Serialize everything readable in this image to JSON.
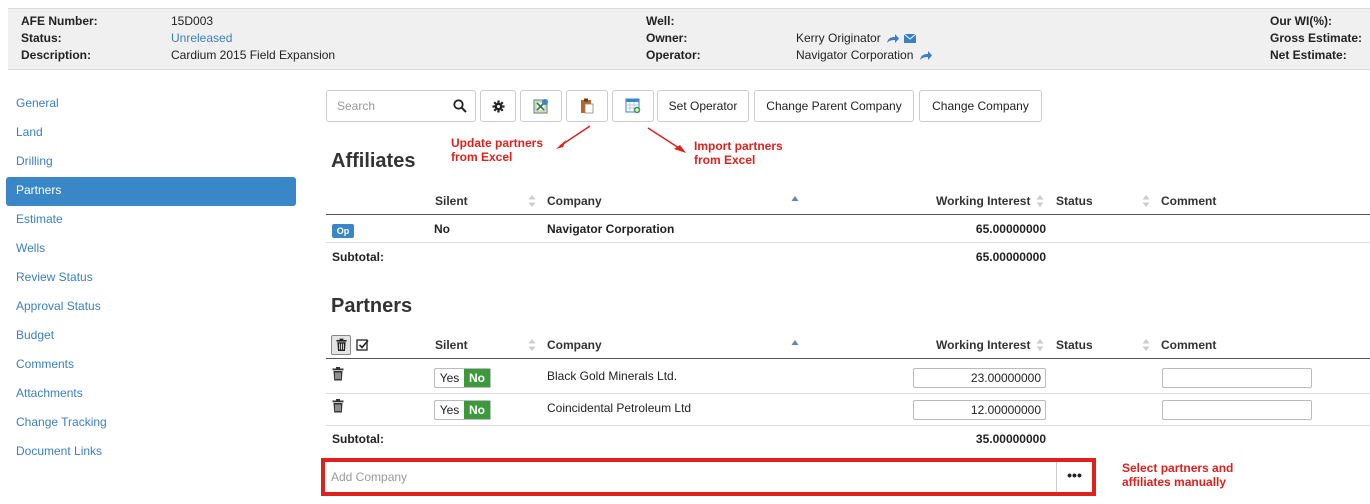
{
  "header": {
    "afe_number_label": "AFE Number:",
    "afe_number_value": "15D003",
    "status_label": "Status:",
    "status_value": "Unreleased",
    "description_label": "Description:",
    "description_value": "Cardium 2015 Field Expansion",
    "well_label": "Well:",
    "well_value": "",
    "owner_label": "Owner:",
    "owner_value": "Kerry Originator",
    "operator_label": "Operator:",
    "operator_value": "Navigator Corporation",
    "our_wi_label": "Our WI(%):",
    "gross_estimate_label": "Gross Estimate:",
    "net_estimate_label": "Net Estimate:"
  },
  "sidebar": {
    "items": [
      {
        "label": "General"
      },
      {
        "label": "Land"
      },
      {
        "label": "Drilling"
      },
      {
        "label": "Partners",
        "active": true
      },
      {
        "label": "Estimate"
      },
      {
        "label": "Wells"
      },
      {
        "label": "Review Status"
      },
      {
        "label": "Approval Status"
      },
      {
        "label": "Budget"
      },
      {
        "label": "Comments"
      },
      {
        "label": "Attachments"
      },
      {
        "label": "Change Tracking"
      },
      {
        "label": "Document Links"
      }
    ]
  },
  "toolbar": {
    "search_placeholder": "Search",
    "set_operator": "Set Operator",
    "change_parent_company": "Change Parent Company",
    "change_company": "Change Company"
  },
  "annotations": {
    "update_partners_line1": "Update partners",
    "update_partners_line2": "from Excel",
    "import_partners_line1": "Import partners",
    "import_partners_line2": "from Excel",
    "select_partners_line1": "Select partners and",
    "select_partners_line2": "affiliates manually"
  },
  "affiliates": {
    "title": "Affiliates",
    "columns": {
      "silent": "Silent",
      "company": "Company",
      "working_interest": "Working Interest",
      "status": "Status",
      "comment": "Comment"
    },
    "rows": [
      {
        "badge": "Op",
        "silent": "No",
        "company": "Navigator Corporation",
        "working_interest": "65.00000000"
      }
    ],
    "subtotal_label": "Subtotal:",
    "subtotal_value": "65.00000000"
  },
  "partners": {
    "title": "Partners",
    "columns": {
      "silent": "Silent",
      "company": "Company",
      "working_interest": "Working Interest",
      "status": "Status",
      "comment": "Comment"
    },
    "toggle_yes": "Yes",
    "toggle_no": "No",
    "rows": [
      {
        "company": "Black Gold Minerals Ltd.",
        "working_interest": "23.00000000"
      },
      {
        "company": "Coincidental Petroleum Ltd",
        "working_interest": "12.00000000"
      }
    ],
    "subtotal_label": "Subtotal:",
    "subtotal_value": "35.00000000"
  },
  "add_company": {
    "placeholder": "Add Company",
    "browse_label": "•••"
  },
  "colors": {
    "accent": "#3a87c7",
    "link": "#3a7fc1",
    "annotation": "#e0201c",
    "toggle_on": "#3c9a3c"
  }
}
